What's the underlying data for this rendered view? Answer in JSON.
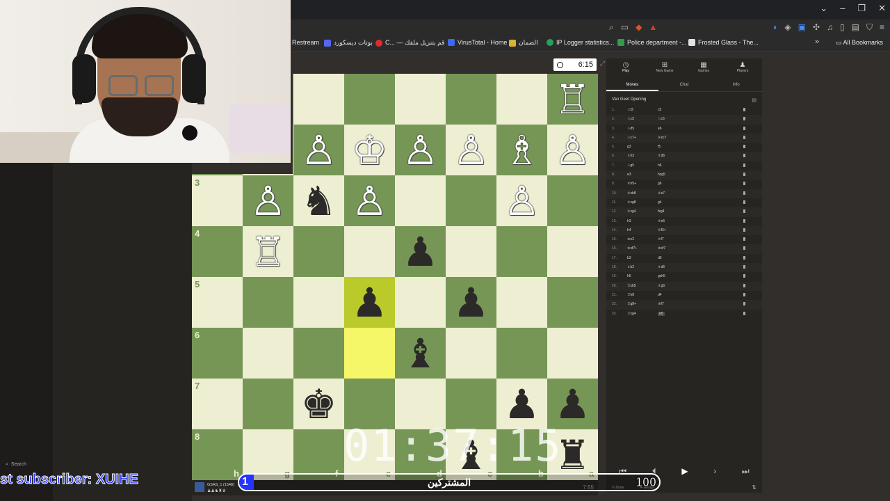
{
  "browser": {
    "window_controls": [
      "⌄",
      "–",
      "❐",
      "✕"
    ],
    "toolbar_icons": [
      "zoom-icon",
      "cast-icon",
      "brave-shield-icon",
      "brave-rewards-icon"
    ],
    "extension_icons": [
      "translate-icon",
      "shield-icon",
      "translate-icon",
      "extensions-icon",
      "media-icon",
      "sidebar-icon",
      "wallet-icon",
      "vpn-icon",
      "menu-icon"
    ],
    "bookmarks": [
      {
        "label": "Restream",
        "color": "#f36c3d"
      },
      {
        "label": "بوتات ديسكورد",
        "color": "#5865f2"
      },
      {
        "label": "C... — قم بتنزيل ملفك",
        "color": "#e02b2b"
      },
      {
        "label": "VirusTotal - Home",
        "color": "#3c68f5"
      },
      {
        "label": "الضمان",
        "color": "#d8b13b"
      },
      {
        "label": "IP Logger statistics...",
        "color": "#21a35b"
      },
      {
        "label": "Police department -...",
        "color": "#2f9e44"
      },
      {
        "label": "Frosted Glass - The...",
        "color": "#e2e2e2"
      }
    ],
    "all_bookmarks": "All Bookmarks"
  },
  "clock": {
    "time": "6:15"
  },
  "board": {
    "ranks": [
      "3",
      "4",
      "5",
      "6",
      "7",
      "8"
    ],
    "files": [
      "h",
      "g",
      "f",
      "e",
      "d",
      "c",
      "b",
      "a"
    ]
  },
  "right_panel": {
    "tabs": [
      {
        "icon": "◷",
        "label": "Play"
      },
      {
        "icon": "⊞",
        "label": "New Game"
      },
      {
        "icon": "▦",
        "label": "Games"
      },
      {
        "icon": "♟",
        "label": "Players"
      }
    ],
    "subtabs": [
      "Moves",
      "Chat",
      "Info"
    ],
    "opening": "Van Geet Opening",
    "moves": [
      {
        "n": "1.",
        "w": "♘f3",
        "b": "c5"
      },
      {
        "n": "2.",
        "w": "♘c3",
        "b": "♘c6"
      },
      {
        "n": "3.",
        "w": "♘d5",
        "b": "e6"
      },
      {
        "n": "4.",
        "w": "♘c7+",
        "b": "♕xc7"
      },
      {
        "n": "5.",
        "w": "g3",
        "b": "f5"
      },
      {
        "n": "6.",
        "w": "♗h3",
        "b": "♗d6"
      },
      {
        "n": "7.",
        "w": "♘g5",
        "b": "h6"
      },
      {
        "n": "8.",
        "w": "e3",
        "b": "hxg5"
      },
      {
        "n": "9.",
        "w": "♕h5+",
        "b": "g6"
      },
      {
        "n": "10.",
        "w": "♕xh8",
        "b": "♕e7"
      },
      {
        "n": "11.",
        "w": "♕xg8",
        "b": "g4"
      },
      {
        "n": "12.",
        "w": "♕xg4",
        "b": "fxg4"
      },
      {
        "n": "13.",
        "w": "h3",
        "b": "♕e5"
      },
      {
        "n": "14.",
        "w": "h4",
        "b": "♕f3+"
      },
      {
        "n": "15.",
        "w": "♔e2",
        "b": "♕f7"
      },
      {
        "n": "16.",
        "w": "♔xf7+",
        "b": "♔xf7"
      },
      {
        "n": "17.",
        "w": "b3",
        "b": "d5"
      },
      {
        "n": "18.",
        "w": "♗b2",
        "b": "♗d6"
      },
      {
        "n": "19.",
        "w": "h5",
        "b": "gxh5"
      },
      {
        "n": "20.",
        "w": "♖xh5",
        "b": "♗g6"
      },
      {
        "n": "21.",
        "w": "♖h8",
        "b": "d4"
      },
      {
        "n": "22.",
        "w": "♖g8+",
        "b": "♔f7"
      },
      {
        "n": "23.",
        "w": "♖xg4",
        "b": "e5"
      }
    ],
    "controls": [
      "⏮",
      "⏴",
      "▶",
      "›",
      "⏭"
    ],
    "draw": "½ Draw",
    "resign": "⚑ Resign",
    "flip": "⇅"
  },
  "player": {
    "name": "GSAS_1 (1548)",
    "captured": "♟♟♞♜♛",
    "time": "7:55"
  },
  "left_panel": {
    "search": "Search",
    "bottom_label": "GSAS_1"
  },
  "overlay": {
    "timer": "01:37:15",
    "latest_sub": "st subscriber: XUIHE",
    "sub_goal_label": "المشتركين",
    "sub_current": "1",
    "sub_goal": "100",
    "sub_progress": 0.01
  }
}
